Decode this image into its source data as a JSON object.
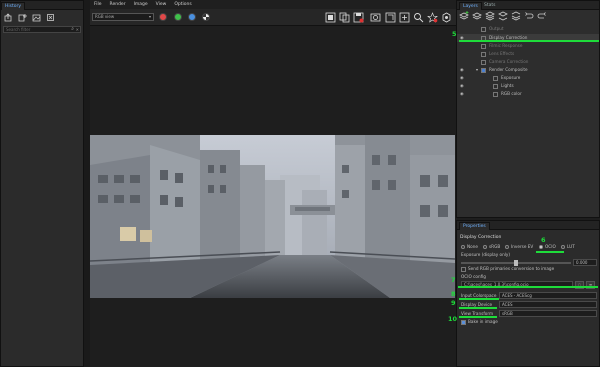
{
  "history": {
    "tab": "History",
    "tools": [
      "export-icon",
      "add-icon",
      "image-icon",
      "delete-icon"
    ],
    "search_placeholder": "Search filter"
  },
  "menu": [
    "File",
    "Render",
    "Image",
    "View",
    "Options"
  ],
  "toolbar": {
    "view_select": "RGB view",
    "channels": [
      "#e04848",
      "#3fc04a",
      "#4a90e0",
      "#cccccc"
    ],
    "icons": [
      "region-icon",
      "copy-icon",
      "save-icon",
      "snapshot-icon",
      "crop-icon",
      "fit-icon",
      "zoom-icon",
      "star-icon",
      "settings-icon"
    ]
  },
  "layers_panel": {
    "tabs": [
      "Layers",
      "Stats"
    ],
    "tools": [
      "add-layer-icon",
      "remove-layer-icon",
      "merge-icon",
      "stack-icon",
      "flatten-icon",
      "undo-icon",
      "redo-icon"
    ],
    "rows": [
      {
        "name": "Output",
        "indent": 0,
        "eye": false
      },
      {
        "name": "Display Correction",
        "indent": 1,
        "eye": true,
        "selected": true
      },
      {
        "name": "Filmic Response",
        "indent": 1,
        "eye": false
      },
      {
        "name": "Lens Effects",
        "indent": 1,
        "eye": false
      },
      {
        "name": "Camera Correction",
        "indent": 1,
        "eye": false
      },
      {
        "name": "Render Composite",
        "indent": 0,
        "eye": true
      },
      {
        "name": "Exposure",
        "indent": 2,
        "eye": true
      },
      {
        "name": "Lights",
        "indent": 2,
        "eye": true
      },
      {
        "name": "RGB color",
        "indent": 2,
        "eye": true
      }
    ]
  },
  "properties": {
    "tab": "Properties",
    "section": "Display Correction",
    "radios": [
      "None",
      "sRGB",
      "Inverse EV",
      "OCIO",
      "LUT"
    ],
    "radio_selected": "OCIO",
    "exposure_label": "Exposure (display only)",
    "exposure_value": "0.000",
    "convert_label": "Send RGB primaries conversion to image",
    "ocio_config_label": "OCIO config",
    "ocio_config_value": "C:\\\\aces\\\\aces_1.0.3\\\\config.ocio",
    "input_label": "Input Colorspace",
    "input_value": "ACES - ACEScg",
    "display_label": "Display Device",
    "display_value": "ACES",
    "view_label": "View Transform",
    "view_value": "sRGB",
    "bake_label": "Bake in image"
  },
  "annotations": [
    "5",
    "6",
    "7",
    "8",
    "9",
    "10"
  ]
}
